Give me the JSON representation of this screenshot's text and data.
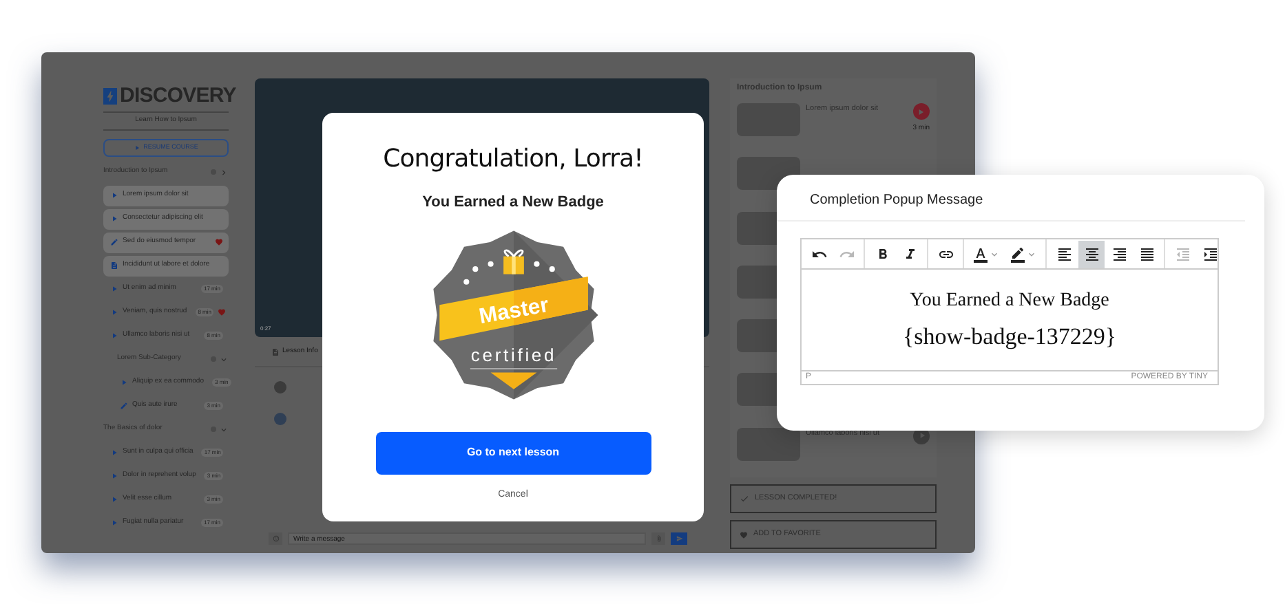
{
  "app": {
    "logo": "DISCOVERY",
    "tagline": "Learn How to Ipsum",
    "resume_button": "RESUME COURSE",
    "sections": [
      {
        "title": "Introduction to Ipsum",
        "expanded": false,
        "items": [
          {
            "kind": "video",
            "title": "Lorem ipsum dolor sit",
            "completed": true,
            "favorite": false
          },
          {
            "kind": "video",
            "title": "Consectetur adipiscing elit",
            "completed": true,
            "favorite": false
          },
          {
            "kind": "quiz",
            "title": "Sed do eiusmod tempor",
            "completed": true,
            "favorite": true
          },
          {
            "kind": "document",
            "title": "Incididunt ut labore et dolore",
            "completed": true,
            "favorite": false
          },
          {
            "kind": "video",
            "title": "Ut enim ad minim",
            "duration": "17 min",
            "completed": false,
            "favorite": false
          },
          {
            "kind": "video",
            "title": "Veniam, quis nostrud",
            "duration": "8 min",
            "completed": false,
            "favorite": true
          },
          {
            "kind": "video",
            "title": "Ullamco laboris nisi ut",
            "duration": "8 min",
            "completed": false,
            "favorite": false
          }
        ],
        "children": [
          {
            "title": "Lorem Sub-Category",
            "expanded": true,
            "items": [
              {
                "kind": "video",
                "title": "Aliquip ex ea commodo",
                "duration": "3 min",
                "completed": false,
                "favorite": false
              },
              {
                "kind": "quiz",
                "title": "Quis aute irure",
                "duration": "3 min",
                "completed": false,
                "favorite": false
              }
            ]
          }
        ]
      },
      {
        "title": "The Basics of dolor",
        "expanded": true,
        "items": [
          {
            "kind": "video",
            "title": "Sunt in culpa qui officia",
            "duration": "17 min",
            "completed": false,
            "favorite": false
          },
          {
            "kind": "video",
            "title": "Dolor in reprehent volup",
            "duration": "3 min",
            "completed": false,
            "favorite": false
          },
          {
            "kind": "video",
            "title": "Velit esse cillum",
            "duration": "3 min",
            "completed": false,
            "favorite": false
          },
          {
            "kind": "video",
            "title": "Fugiat nulla pariatur",
            "duration": "17 min",
            "completed": false,
            "favorite": false
          }
        ]
      }
    ],
    "video": {
      "time": "0:27"
    },
    "lesson_tab": "Lesson Info",
    "message_field": {
      "placeholder": "Write a message"
    },
    "playlist": {
      "title": "Introduction to Ipsum",
      "lessons": [
        {
          "kind": "video",
          "title": "Lorem ipsum dolor sit",
          "duration": "3 min",
          "playing": true
        },
        {
          "kind": "video"
        },
        {
          "kind": "video"
        },
        {
          "kind": "video"
        },
        {
          "kind": "video"
        },
        {
          "kind": "video"
        },
        {
          "kind": "video",
          "title": "Ullamco laboris nisi ut",
          "playing": false
        }
      ]
    },
    "actions": [
      {
        "kind": "complete",
        "label": "LESSON COMPLETED!"
      },
      {
        "kind": "favorite",
        "label": "ADD TO FAVORITE"
      }
    ]
  },
  "modal": {
    "title": "Congratulation, Lorra!",
    "subtitle": "You Earned a New Badge",
    "badge": {
      "ribbon": "Master",
      "caption": "certified"
    },
    "primary_button": "Go to next lesson",
    "cancel_link": "Cancel"
  },
  "editor_card": {
    "title": "Completion Popup Message",
    "toolbar": [
      [
        {
          "kind": "undo",
          "disabled": false
        },
        {
          "kind": "redo",
          "disabled": true
        }
      ],
      [
        {
          "kind": "bold",
          "disabled": false
        },
        {
          "kind": "italic",
          "disabled": false
        }
      ],
      [
        {
          "kind": "link",
          "disabled": false
        }
      ],
      [
        {
          "kind": "text-color",
          "disabled": false
        },
        {
          "kind": "highlight",
          "disabled": false
        }
      ],
      [
        {
          "kind": "align-left",
          "selected": false
        },
        {
          "kind": "align-center",
          "selected": true
        },
        {
          "kind": "align-right",
          "selected": false
        },
        {
          "kind": "align-justify",
          "selected": false
        }
      ],
      [
        {
          "kind": "outdent",
          "disabled": true
        },
        {
          "kind": "indent",
          "disabled": false
        }
      ]
    ],
    "content": [
      "You Earned a New Badge",
      "{show-badge-137229}"
    ],
    "status_path": "P",
    "branding": "POWERED BY TINY"
  }
}
